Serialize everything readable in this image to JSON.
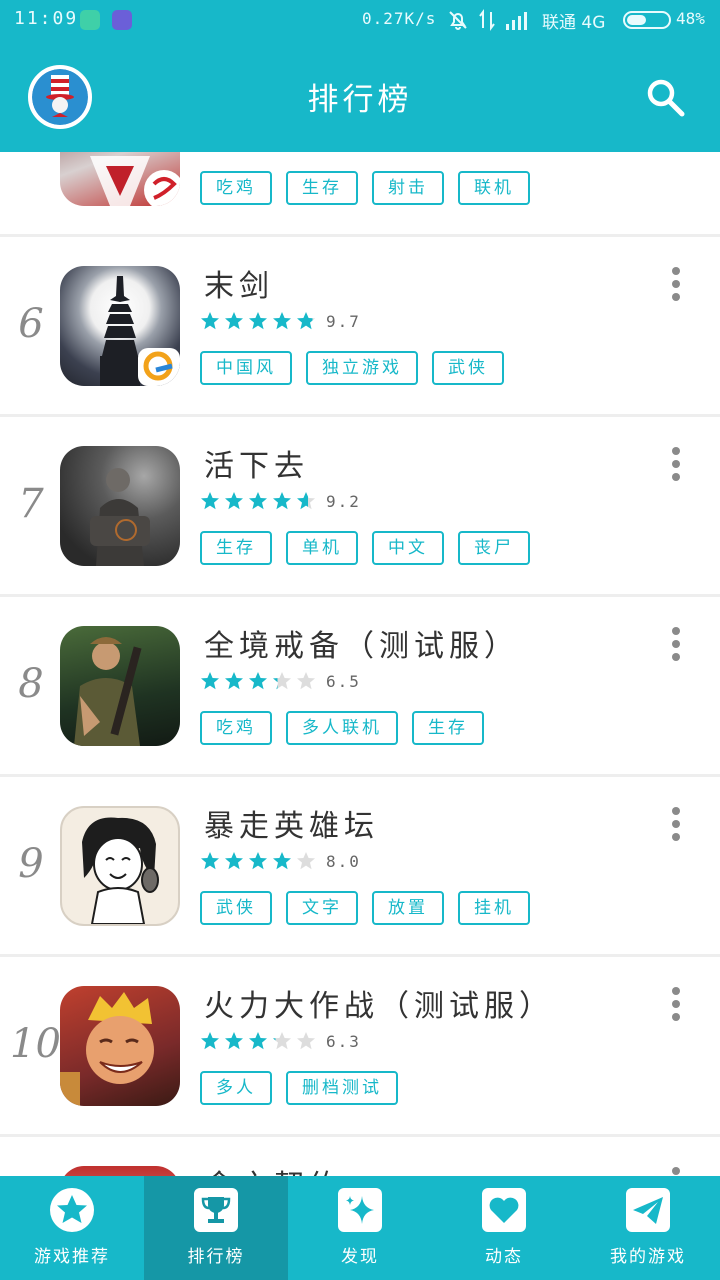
{
  "status_bar": {
    "time": "11:09",
    "speed": "0.27K/s",
    "carrier": "联通 4G",
    "battery_pct": "48%",
    "battery_level": 0.48
  },
  "app_bar": {
    "title": "排行榜"
  },
  "ranking": [
    {
      "rank": "",
      "name": "",
      "rating": null,
      "score": "",
      "tags": [
        "吃鸡",
        "生存",
        "射击",
        "联机"
      ]
    },
    {
      "rank": "6",
      "name": "末剑",
      "rating": 4.85,
      "score": "9.7",
      "tags": [
        "中国风",
        "独立游戏",
        "武侠"
      ]
    },
    {
      "rank": "7",
      "name": "活下去",
      "rating": 4.6,
      "score": "9.2",
      "tags": [
        "生存",
        "单机",
        "中文",
        "丧尸"
      ]
    },
    {
      "rank": "8",
      "name": "全境戒备（测试服）",
      "rating": 3.25,
      "score": "6.5",
      "tags": [
        "吃鸡",
        "多人联机",
        "生存"
      ]
    },
    {
      "rank": "9",
      "name": "暴走英雄坛",
      "rating": 4.0,
      "score": "8.0",
      "tags": [
        "武侠",
        "文字",
        "放置",
        "挂机"
      ]
    },
    {
      "rank": "10",
      "name": "火力大作战（测试服）",
      "rating": 3.15,
      "score": "6.3",
      "tags": [
        "多人",
        "删档测试"
      ]
    },
    {
      "rank": "",
      "name": "食之契约",
      "rating": null,
      "score": "",
      "tags": []
    }
  ],
  "bottom_nav": {
    "items": [
      {
        "label": "游戏推荐",
        "icon": "star-icon"
      },
      {
        "label": "排行榜",
        "icon": "trophy-icon",
        "active": true
      },
      {
        "label": "发现",
        "icon": "sparkle-icon"
      },
      {
        "label": "动态",
        "icon": "heart-icon"
      },
      {
        "label": "我的游戏",
        "icon": "paper-plane-icon"
      }
    ]
  },
  "colors": {
    "primary": "#17b8c9",
    "active_tab": "#1597a6",
    "star_filled": "#17b8c9",
    "star_empty": "#dddddd"
  }
}
